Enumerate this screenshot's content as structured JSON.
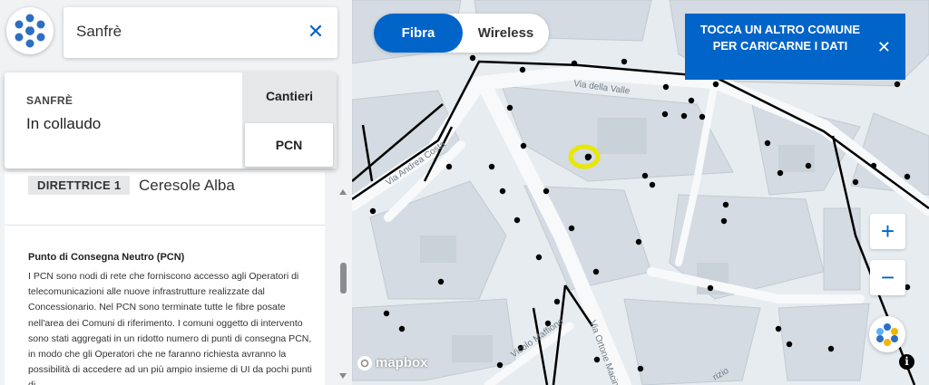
{
  "search": {
    "value": "Sanfrè",
    "clear_icon": "close-icon"
  },
  "info_card": {
    "municipality": "SANFRÈ",
    "status": "In collaudo",
    "tabs": [
      {
        "label": "Cantieri"
      },
      {
        "label": "PCN"
      }
    ]
  },
  "details": {
    "chip_label": "DIRETTRICE 1",
    "chip_value": "Ceresole Alba",
    "section_title": "Punto di Consegna Neutro (PCN)",
    "section_body": "I PCN sono nodi di rete che forniscono accesso agli Operatori di telecomunicazioni alle nuove infrastrutture realizzate dal Concessionario. Nel PCN sono terminate tutte le fibre posate nell'area dei Comuni di riferimento. I comuni oggetto di intervento sono stati aggregati in un ridotto numero di punti di consegna PCN, in modo che gli Operatori che ne faranno richiesta avranno la possibilità di accedere ad un più ampio insieme di UI da pochi punti di"
  },
  "network_toggle": {
    "options": [
      {
        "label": "Fibra",
        "active": true
      },
      {
        "label": "Wireless",
        "active": false
      }
    ]
  },
  "notice": {
    "text": "TOCCA UN ALTRO COMUNE PER CARICARNE I DATI"
  },
  "zoom": {
    "in_label": "+",
    "out_label": "−"
  },
  "map": {
    "attribution": "mapbox",
    "street_labels": [
      "Via della Valle",
      "Via Andrea Costa",
      "Vicolo Maffione",
      "Via Ortone Macinaio",
      "rizio"
    ]
  },
  "colors": {
    "brand_blue": "#0064c8",
    "highlight": "#e8e800",
    "map_bg": "#e7ecf0",
    "building": "#d4dbe2"
  }
}
